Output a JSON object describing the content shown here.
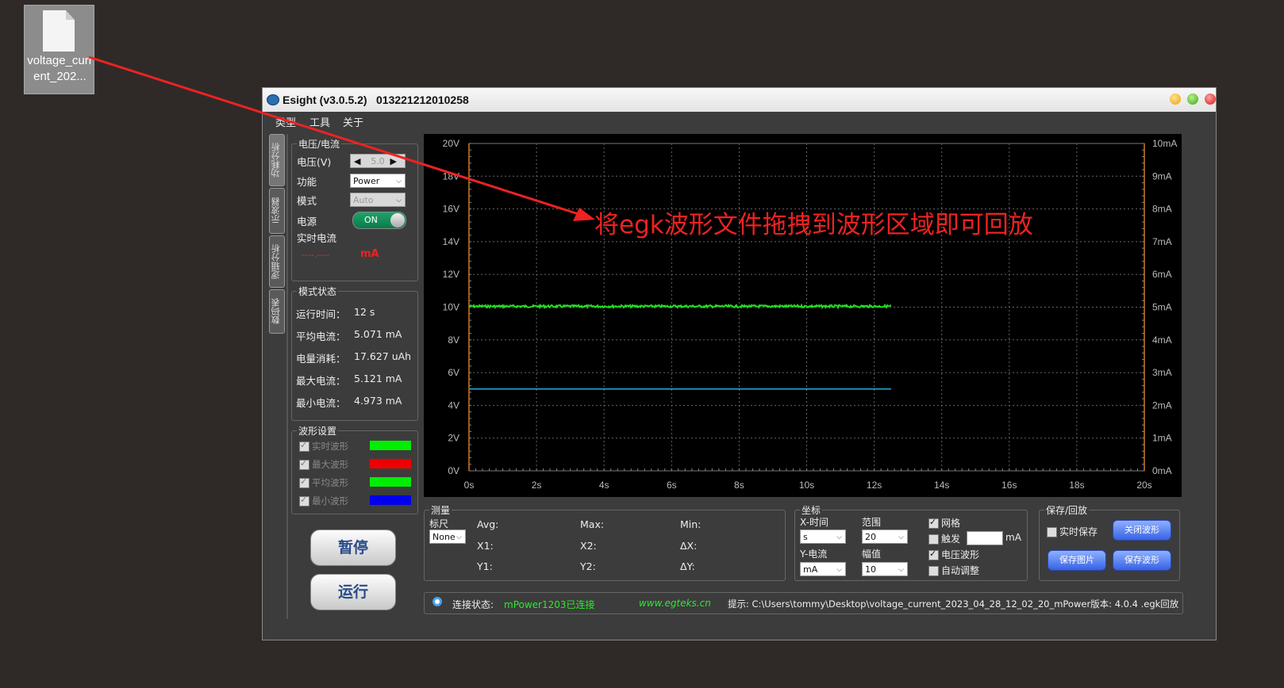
{
  "desktop_icon": {
    "label": "voltage_current_202..."
  },
  "window": {
    "title": "Esight (v3.0.5.2)",
    "serial": "013221212010258"
  },
  "menu": [
    "类型",
    "工具",
    "关于"
  ],
  "side_tabs": [
    "功耗分析",
    "示波器",
    "逻辑分析",
    "数码表"
  ],
  "vc_panel": {
    "legend": "电压/电流",
    "voltage_label": "电压(V)",
    "voltage_value": "5.0",
    "function_label": "功能",
    "function_value": "Power",
    "mode_label": "模式",
    "mode_value": "Auto",
    "power_label": "电源",
    "power_toggle": "ON",
    "realtime_label": "实时电流",
    "realtime_value": "----.----",
    "realtime_unit": "mA"
  },
  "mode_status": {
    "legend": "模式状态",
    "rows": [
      {
        "label": "运行时间：",
        "value": "12 s"
      },
      {
        "label": "平均电流：",
        "value": "5.071 mA"
      },
      {
        "label": "电量消耗：",
        "value": "17.627 uAh"
      },
      {
        "label": "最大电流：",
        "value": "5.121 mA"
      },
      {
        "label": "最小电流：",
        "value": "4.973 mA"
      }
    ]
  },
  "wave_settings": {
    "legend": "波形设置",
    "rows": [
      {
        "label": "实时波形",
        "color": "#00ee00"
      },
      {
        "label": "最大波形",
        "color": "#ee0000"
      },
      {
        "label": "平均波形",
        "color": "#00ee00"
      },
      {
        "label": "最小波形",
        "color": "#0000ee"
      }
    ]
  },
  "buttons": {
    "pause": "暂停",
    "run": "运行"
  },
  "chart_data": {
    "type": "line",
    "x_ticks": [
      "0s",
      "2s",
      "4s",
      "6s",
      "8s",
      "10s",
      "12s",
      "14s",
      "16s",
      "18s",
      "20s"
    ],
    "y_left_ticks": [
      "20V",
      "18V",
      "16V",
      "14V",
      "12V",
      "10V",
      "8V",
      "6V",
      "4V",
      "2V",
      "0V"
    ],
    "y_right_ticks": [
      "10mA",
      "9mA",
      "8mA",
      "7mA",
      "6mA",
      "5mA",
      "4mA",
      "3mA",
      "2mA",
      "1mA",
      "0mA"
    ],
    "xlim": [
      0,
      20
    ],
    "ylim_left": [
      0,
      20
    ],
    "ylim_right": [
      0,
      10
    ],
    "grid": true,
    "series": [
      {
        "color": "#22dd22",
        "axis": "left",
        "x": [
          0,
          12.5
        ],
        "y": [
          10.05,
          10.05
        ],
        "noisy": true
      },
      {
        "color": "#22aadd",
        "axis": "left",
        "x": [
          0,
          12.5
        ],
        "y": [
          5.0,
          5.0
        ]
      }
    ],
    "annotation": "将egk波形文件拖拽到波形区域即可回放"
  },
  "measure": {
    "legend": "测量",
    "ruler_label": "标尺",
    "ruler_value": "None",
    "avg": "Avg:",
    "max": "Max:",
    "min": "Min:",
    "x1": "X1:",
    "x2": "X2:",
    "dx": "ΔX:",
    "y1": "Y1:",
    "y2": "Y2:",
    "dy": "ΔY:"
  },
  "coords": {
    "legend": "坐标",
    "x_label": "X-时间",
    "x_unit": "s",
    "range_label": "范围",
    "range_value": "20",
    "y_label": "Y-电流",
    "y_unit": "mA",
    "amp_label": "幅值",
    "amp_value": "10",
    "grid": "网格",
    "trigger": "触发",
    "trigger_unit": "mA",
    "voltage_wave": "电压波形",
    "auto_adjust": "自动调整"
  },
  "save": {
    "legend": "保存/回放",
    "realtime_save": "实时保存",
    "close_wave": "关闭波形",
    "save_image": "保存图片",
    "save_wave": "保存波形"
  },
  "status_bar": {
    "conn_label": "连接状态:",
    "conn_value": "mPower1203已连接",
    "website": "www.egteks.cn",
    "hint": "提示:  C:\\Users\\tommy\\Desktop\\voltage_current_2023_04_28_12_02_20_mPower版本: 4.0.4 .egk回放"
  }
}
